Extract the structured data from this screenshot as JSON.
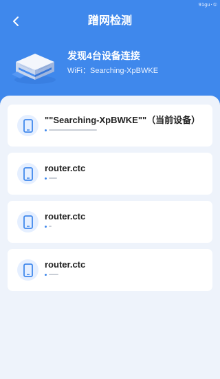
{
  "header": {
    "watermark": "91gu·①",
    "title": "蹭网检测",
    "back_icon": "chevron-left-icon",
    "found_text": "发现4台设备连接",
    "wifi_text": "WiFi：Searching-XpBWKE",
    "background": "#3f88ec"
  },
  "devices": [
    {
      "name": "\"\"Searching-XpBWKE\"\"（当前设备）",
      "icon": "phone-icon"
    },
    {
      "name": "router.ctc",
      "icon": "phone-icon"
    },
    {
      "name": "router.ctc",
      "icon": "phone-icon"
    },
    {
      "name": "router.ctc",
      "icon": "phone-icon"
    }
  ],
  "colors": {
    "accent": "#3f88ec",
    "list_bg": "#eef3fb",
    "card_bg": "#ffffff"
  }
}
